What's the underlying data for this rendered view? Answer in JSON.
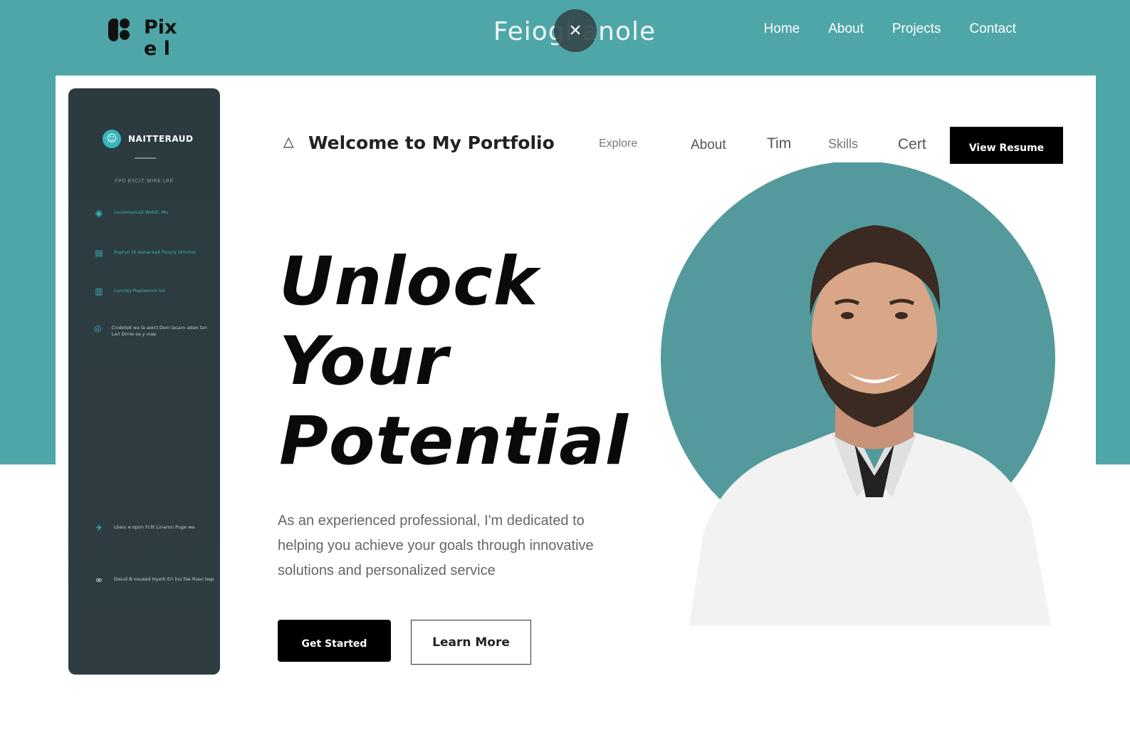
{
  "topbar": {
    "logo_text": "Pixe l",
    "brand_title": "Feiogl anole",
    "close_symbol": "×",
    "nav": [
      "Home",
      "About",
      "Projects",
      "Contact"
    ]
  },
  "sidebar": {
    "brand": "NAITTERAUD",
    "subtitle": "FPO ESCLT WIRE LRE",
    "items": [
      {
        "icon": "globe-icon",
        "label": "Luceroiuniad Wobit: Mo"
      },
      {
        "icon": "chart-icon",
        "label": "Rspryn Hi Aonaraad Pooyly Drivinio"
      },
      {
        "icon": "document-icon",
        "label": "Lunrtey Raplaevce loo"
      },
      {
        "icon": "eye-icon",
        "label": "Civdolod wa la aoict Dsni lacaro adan tan Lari Drnie sa y viaa"
      },
      {
        "icon": "bird-icon",
        "label": "Lbaiu e opon Fclit Linarnn Puge wa"
      },
      {
        "icon": "link-icon",
        "label": "Daiud B noused Hyarh Eri lnu fee Riavi bap"
      }
    ]
  },
  "header": {
    "logo_symbol": "△",
    "title": "Welcome to My Portfolio",
    "nav": [
      "Explore",
      "About",
      "Tim",
      "Skills",
      "Cert"
    ],
    "resume_button": "View Resume"
  },
  "hero": {
    "title_lines": [
      "Unlock",
      "Your",
      "Potential"
    ],
    "description": "As an experienced professional, I'm dedicated to helping you achieve your goals through innovative solutions and personalized service",
    "primary_button": "Get Started",
    "secondary_button": "Learn More"
  },
  "colors": {
    "teal": "#4fa6a8",
    "sidebar": "#2e3c41",
    "accent": "#37b6bb",
    "portrait_circle": "#549a9c"
  }
}
